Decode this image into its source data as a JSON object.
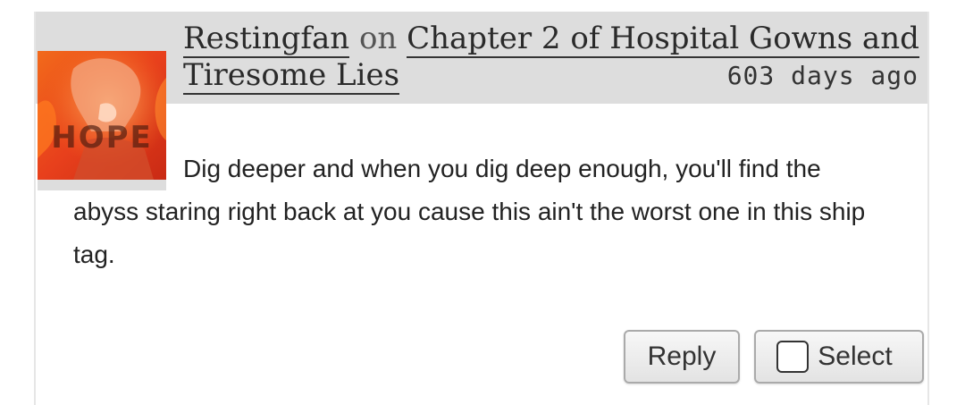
{
  "comment": {
    "author": "Restingfan",
    "connector": "on",
    "work_link": "Chapter 2 of Hospital Gowns and Tiresome Lies",
    "timestamp": "603 days ago",
    "avatar_text": "HOPE",
    "body": "Dig deeper and when you dig deep enough, you'll find the abyss staring right back at you cause this ain't the worst one in this ship tag."
  },
  "actions": {
    "reply_label": "Reply",
    "select_label": "Select"
  },
  "colors": {
    "header_bg": "#dddddd",
    "avatar_accent": "#e8401c"
  }
}
